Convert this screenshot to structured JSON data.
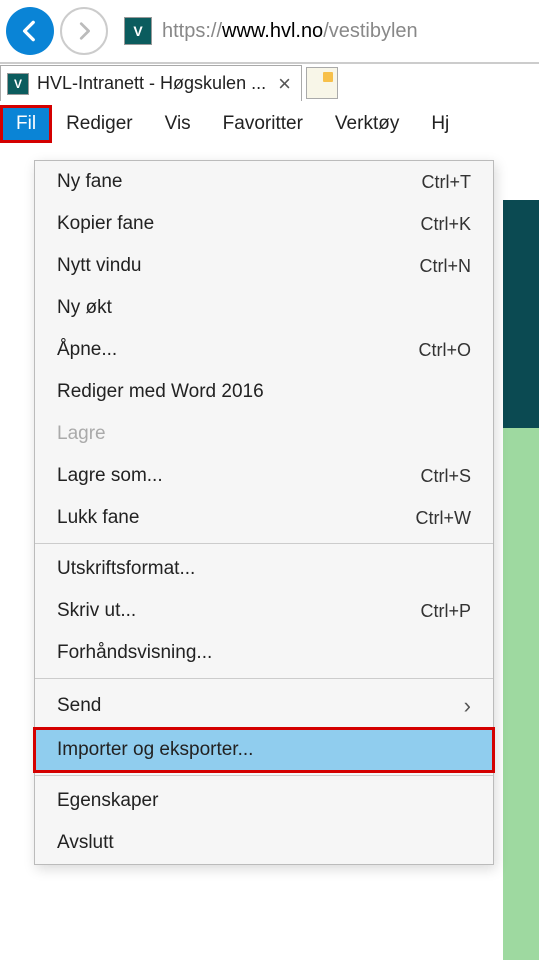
{
  "toolbar": {
    "url_gray1": "https://",
    "url_black": "www.hvl.no",
    "url_gray2": "/vestibylen",
    "favicon_text": "V"
  },
  "tab": {
    "title": "HVL-Intranett - Høgskulen ...",
    "favicon_text": "V"
  },
  "menubar": {
    "items": [
      "Fil",
      "Rediger",
      "Vis",
      "Favoritter",
      "Verktøy",
      "Hj"
    ]
  },
  "menu": {
    "items": [
      {
        "label": "Ny fane",
        "shortcut": "Ctrl+T"
      },
      {
        "label": "Kopier fane",
        "shortcut": "Ctrl+K"
      },
      {
        "label": "Nytt vindu",
        "shortcut": "Ctrl+N"
      },
      {
        "label": "Ny økt",
        "shortcut": ""
      },
      {
        "label": "Åpne...",
        "shortcut": "Ctrl+O"
      },
      {
        "label": "Rediger med Word 2016",
        "shortcut": ""
      },
      {
        "label": "Lagre",
        "shortcut": "",
        "disabled": true
      },
      {
        "label": "Lagre som...",
        "shortcut": "Ctrl+S"
      },
      {
        "label": "Lukk fane",
        "shortcut": "Ctrl+W"
      },
      {
        "sep": true
      },
      {
        "label": "Utskriftsformat...",
        "shortcut": ""
      },
      {
        "label": "Skriv ut...",
        "shortcut": "Ctrl+P"
      },
      {
        "label": "Forhåndsvisning...",
        "shortcut": ""
      },
      {
        "sep": true
      },
      {
        "label": "Send",
        "shortcut": "",
        "submenu": true
      },
      {
        "label": "Importer og eksporter...",
        "shortcut": "",
        "highlighted": true
      },
      {
        "sep": true
      },
      {
        "label": "Egenskaper",
        "shortcut": ""
      },
      {
        "label": "Avslutt",
        "shortcut": ""
      }
    ]
  }
}
